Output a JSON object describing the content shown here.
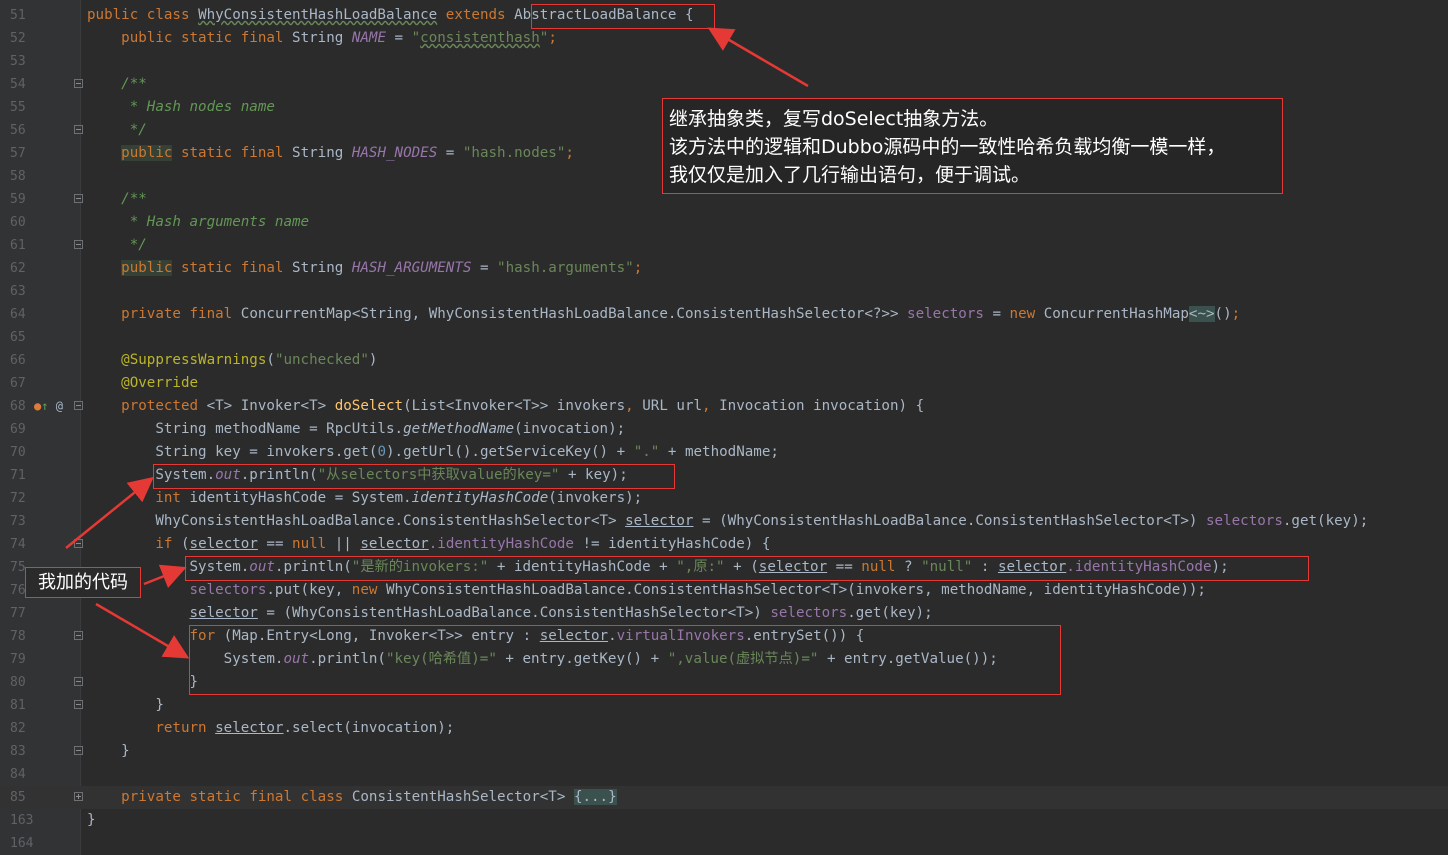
{
  "editor": {
    "lines": [
      {
        "num": "51"
      },
      {
        "num": "52"
      },
      {
        "num": "53"
      },
      {
        "num": "54"
      },
      {
        "num": "55"
      },
      {
        "num": "56"
      },
      {
        "num": "57"
      },
      {
        "num": "58"
      },
      {
        "num": "59"
      },
      {
        "num": "60"
      },
      {
        "num": "61"
      },
      {
        "num": "62"
      },
      {
        "num": "63"
      },
      {
        "num": "64"
      },
      {
        "num": "65"
      },
      {
        "num": "66"
      },
      {
        "num": "67"
      },
      {
        "num": "68"
      },
      {
        "num": "69"
      },
      {
        "num": "70"
      },
      {
        "num": "71"
      },
      {
        "num": "72"
      },
      {
        "num": "73"
      },
      {
        "num": "74"
      },
      {
        "num": "75"
      },
      {
        "num": "76"
      },
      {
        "num": "77"
      },
      {
        "num": "78"
      },
      {
        "num": "79"
      },
      {
        "num": "80"
      },
      {
        "num": "81"
      },
      {
        "num": "82"
      },
      {
        "num": "83"
      },
      {
        "num": "84"
      },
      {
        "num": "85"
      },
      {
        "num": "163"
      },
      {
        "num": "164"
      }
    ],
    "tokens": {
      "public": "public",
      "class": "class",
      "static": "static",
      "final": "final",
      "extends": "extends",
      "private": "private",
      "new": "new",
      "protected": "protected",
      "int": "int",
      "if": "if",
      "null": "null",
      "for": "for",
      "return": "return",
      "String": "String",
      "class_name": "WhyConsistentHashLoadBalance",
      "parent_class": "AbstractLoadBalance",
      "name_const": "NAME",
      "name_value": "consistenthash",
      "comment_open": "/**",
      "comment_close": "*/",
      "hash_nodes_comment": "* Hash nodes name",
      "hash_nodes_const": "HASH_NODES",
      "hash_nodes_value": "\"hash.nodes\"",
      "hash_args_comment": "* Hash arguments name",
      "hash_args_const": "HASH_ARGUMENTS",
      "hash_args_value": "\"hash.arguments\"",
      "selectors_type": "ConcurrentMap<String, WhyConsistentHashLoadBalance.ConsistentHashSelector<?>>",
      "selectors_field": "selectors",
      "concurrent_hash_map": "ConcurrentHashMap",
      "diamond": "<~>",
      "suppress": "@SuppressWarnings",
      "unchecked": "\"unchecked\"",
      "override": "@Override",
      "do_select": "doSelect",
      "l69_type": "String methodName = RpcUtils.",
      "get_method_name": "getMethodName",
      "l69_end": "(invocation);",
      "l70_code": "String key = invokers.get(",
      "zero": "0",
      "l70_mid": ").getUrl().getServiceKey() + ",
      "dot_str": "\".\"",
      "l70_end": " + methodName;",
      "sys": "System.",
      "out": "out",
      "println": ".println(",
      "l71_str": "\"从selectors中获取value的key=\"",
      "l71_end": " + key);",
      "l72_mid": " identityHashCode = System.",
      "identity_hash_code": "identityHashCode",
      "l72_end": "(invokers);",
      "l73_cast": "WhyConsistentHashLoadBalance.ConsistentHashSelector<T> ",
      "selector": "selector",
      "l73_mid": " = (WhyConsistentHashLoadBalance.ConsistentHashSelector<T>) ",
      "l73_end": ".get(key);",
      "l74_a": " (",
      "l74_b": " == ",
      "l74_c": " || ",
      "l74_d": ".identityHashCode",
      "l74_e": " != identityHashCode) {",
      "l75_str1": "\"是新的invokers:\"",
      "l75_mid1": " + identityHashCode + ",
      "l75_str2": "\",原:\"",
      "l75_mid2": " + (",
      "l75_q": " ? ",
      "l75_null_str": "\"null\"",
      "l75_colon": " : ",
      "l75_end": ");",
      "l76_a": ".put(key, ",
      "l76_b": " WhyConsistentHashLoadBalance.ConsistentHashSelector<T>(invokers, methodName, identityHashCode));",
      "l77_a": " = (WhyConsistentHashLoadBalance.ConsistentHashSelector<T>) ",
      "l77_b": ".get(key);",
      "l78_a": " (Map.Entry<Long, Invoker<T>> entry : ",
      "virtual_invokers": "virtualInvokers",
      "l78_b": ".entrySet()) {",
      "l79_str1": "\"key(哈希值)=\"",
      "l79_mid": " + entry.getKey() + ",
      "l79_str2": "\",value(虚拟节点)=\"",
      "l79_end": " + entry.getValue());",
      "close_brace": "}",
      "l82_end": ".select(invocation);",
      "inner_class": "ConsistentHashSelector<T>",
      "folded": "{...}"
    }
  },
  "annotations": {
    "note_lines": [
      "继承抽象类，复写doSelect抽象方法。",
      "该方法中的逻辑和Dubbo源码中的一致性哈希负载均衡一模一样，",
      "我仅仅是加入了几行输出语句，便于调试。"
    ],
    "label": "我加的代码",
    "highlight_color": "#e53935"
  }
}
